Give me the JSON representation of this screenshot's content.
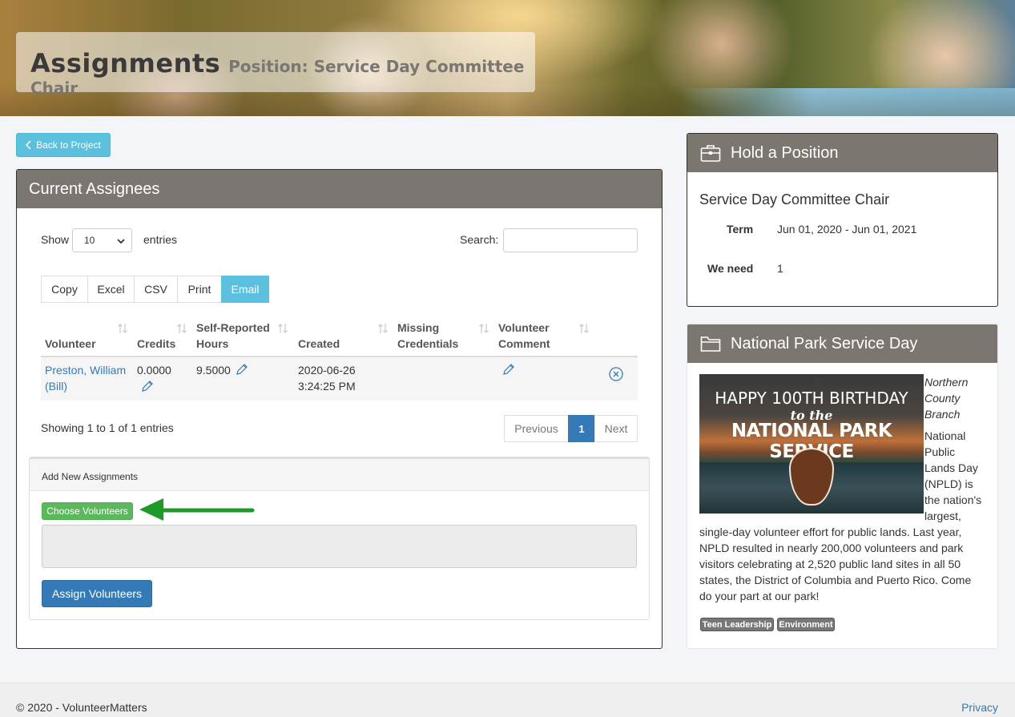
{
  "header": {
    "title": "Assignments",
    "subtitle": "Position: Service Day Committee Chair"
  },
  "back_button": "Back to Project",
  "assignees": {
    "panel_title": "Current Assignees",
    "show_label": "Show",
    "entries_value": "10",
    "entries_label": "entries",
    "search_label": "Search:",
    "search_value": "",
    "export_buttons": [
      "Copy",
      "Excel",
      "CSV",
      "Print",
      "Email"
    ],
    "columns": {
      "volunteer": "Volunteer",
      "credits": "Credits",
      "hours_1": "Self-Reported",
      "hours_2": "Hours",
      "created": "Created",
      "missing_1": "Missing",
      "missing_2": "Credentials",
      "comment_1": "Volunteer",
      "comment_2": "Comment"
    },
    "row": {
      "volunteer_1": "Preston, William",
      "volunteer_2": "(Bill)",
      "credits": "0.0000",
      "hours": "9.5000",
      "created_date": "2020-06-26",
      "created_time": "3:24:25 PM"
    },
    "showing": "Showing 1 to 1 of 1 entries",
    "pagination": {
      "previous": "Previous",
      "current": "1",
      "next": "Next"
    }
  },
  "add_new": {
    "title": "Add New Assignments",
    "choose_button": "Choose Volunteers",
    "textarea_value": "",
    "assign_button": "Assign Volunteers"
  },
  "position_panel": {
    "title": "Hold a Position",
    "position_name": "Service Day Committee Chair",
    "term_label": "Term",
    "term_value": "Jun 01, 2020 - Jun 01, 2021",
    "need_label": "We need",
    "need_value": "1"
  },
  "project_panel": {
    "title": "National Park Service Day",
    "image": {
      "line1": "HAPPY 100TH BIRTHDAY",
      "line2": "to the",
      "line3": "NATIONAL PARK SERVICE"
    },
    "branch_lines": [
      "Northern",
      "County",
      "Branch"
    ],
    "desc_side": [
      "National",
      "Public",
      "Lands Day",
      "(NPLD) is",
      "the nation's",
      "largest,"
    ],
    "desc_full": [
      "single-day volunteer effort for public lands. Last year,",
      "NPLD resulted in nearly 200,000 volunteers and park",
      "visitors celebrating at 2,520 public land sites in all 50",
      "states, the District of Columbia and Puerto Rico. Come",
      "do your part at our park!"
    ],
    "tags": [
      "Teen Leadership",
      "Environment"
    ]
  },
  "footer": {
    "copyright": "© 2020 - VolunteerMatters",
    "privacy": "Privacy"
  },
  "colors": {
    "panel_header": "#7b7770",
    "accent_info": "#5bc0de",
    "primary": "#337ab7",
    "success": "#5cb85c",
    "arrow": "#1e9a2a"
  }
}
